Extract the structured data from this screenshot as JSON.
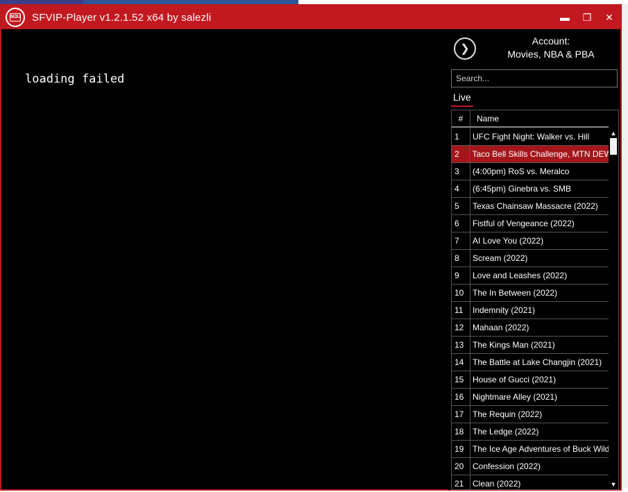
{
  "window": {
    "title": "SFVIP-Player v1.2.1.52 x64 by salezli",
    "logo_text": "M3U",
    "controls": {
      "minimize": "▬",
      "maximize": "❐",
      "close": "✕"
    }
  },
  "player": {
    "status": "loading failed"
  },
  "account": {
    "label": "Account:",
    "name": "Movies, NBA & PBA"
  },
  "search": {
    "placeholder": "Search..."
  },
  "tabs": [
    {
      "label": "Live"
    }
  ],
  "table": {
    "headers": {
      "num": "#",
      "name": "Name"
    },
    "selected_index": 1,
    "rows": [
      {
        "num": "1",
        "name": "UFC Fight Night: Walker vs. Hill"
      },
      {
        "num": "2",
        "name": "Taco Bell Skills Challenge, MTN DEW"
      },
      {
        "num": "3",
        "name": "(4:00pm) RoS vs. Meralco"
      },
      {
        "num": "4",
        "name": "(6:45pm) Ginebra vs. SMB"
      },
      {
        "num": "5",
        "name": "Texas Chainsaw Massacre (2022)"
      },
      {
        "num": "6",
        "name": "Fistful of Vengeance (2022)"
      },
      {
        "num": "7",
        "name": "AI Love You (2022)"
      },
      {
        "num": "8",
        "name": "Scream (2022)"
      },
      {
        "num": "9",
        "name": "Love and Leashes (2022)"
      },
      {
        "num": "10",
        "name": "The In Between (2022)"
      },
      {
        "num": "11",
        "name": "Indemnity (2021)"
      },
      {
        "num": "12",
        "name": "Mahaan (2022)"
      },
      {
        "num": "13",
        "name": "The Kings Man (2021)"
      },
      {
        "num": "14",
        "name": "The Battle at Lake Changjin (2021)"
      },
      {
        "num": "15",
        "name": "House of Gucci (2021)"
      },
      {
        "num": "16",
        "name": "Nightmare Alley (2021)"
      },
      {
        "num": "17",
        "name": "The Requin (2022)"
      },
      {
        "num": "18",
        "name": "The Ledge (2022)"
      },
      {
        "num": "19",
        "name": "The Ice Age Adventures of Buck Wild"
      },
      {
        "num": "20",
        "name": "Confession (2022)"
      },
      {
        "num": "21",
        "name": "Clean (2022)"
      }
    ]
  },
  "colors": {
    "accent": "#c2181f",
    "selected_row": "#a4161a",
    "background": "#000000"
  }
}
